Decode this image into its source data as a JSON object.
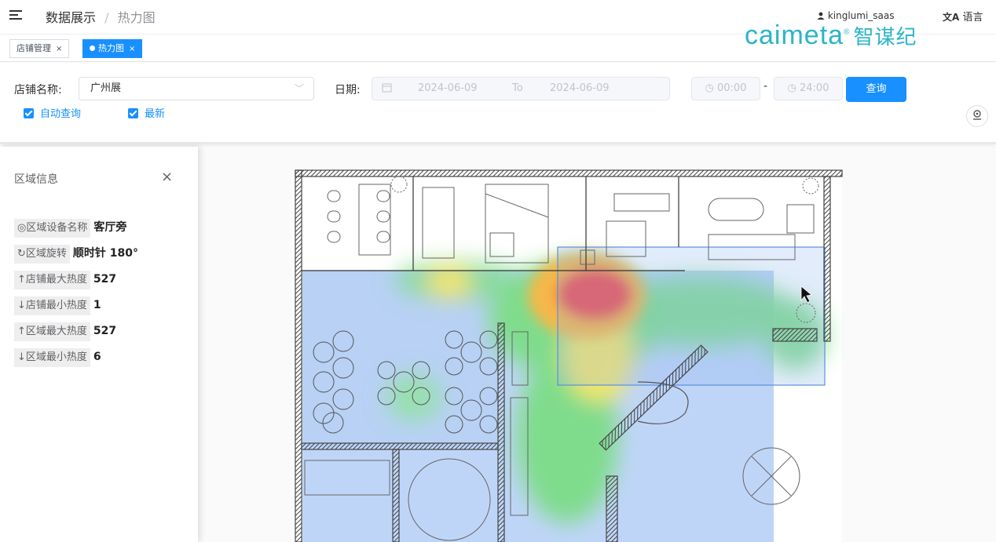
{
  "header": {
    "breadcrumb_root": "数据展示",
    "breadcrumb_sep": "/",
    "breadcrumb_current": "热力图",
    "user_name": "kinglumi_saas",
    "language": "语言",
    "logo_text": "caimeta",
    "logo_mark": "®",
    "logo_cn": "智谋纪"
  },
  "tabs": [
    {
      "label": "店铺管理",
      "close": "×",
      "active": false
    },
    {
      "label": "热力图",
      "close": "×",
      "active": true
    }
  ],
  "filter": {
    "store_label": "店铺名称:",
    "store_value": "广州展",
    "date_label": "日期:",
    "date_start": "2024-06-09",
    "date_to": "To",
    "date_end": "2024-06-09",
    "time_start": "00:00",
    "time_dash": "-",
    "time_end": "24:00",
    "query_button": "查询",
    "auto_query": "自动查询",
    "latest": "最新"
  },
  "panel": {
    "title": "区域信息",
    "close": "×",
    "rows": [
      {
        "label": "◎区域设备名称",
        "value": "客厅旁"
      },
      {
        "label": "↻区域旋转",
        "value": "顺时针 180°"
      },
      {
        "label": "↑店铺最大热度",
        "value": "527"
      },
      {
        "label": "↓店铺最小热度",
        "value": "1"
      },
      {
        "label": "↑区域最大热度",
        "value": "527"
      },
      {
        "label": "↓区域最小热度",
        "value": "6"
      }
    ]
  },
  "colors": {
    "primary": "#1890ff",
    "logo": "#2bb5c7",
    "heat_low": "#a9c7f5",
    "heat_mid": "#7fdc8c",
    "heat_high": "#f5e66a",
    "heat_max": "#f05050"
  },
  "icons": {
    "menu": "menu-fold-icon",
    "user": "user-icon",
    "language": "translate-icon",
    "calendar": "calendar-icon",
    "clock": "clock-icon",
    "locate": "locate-icon",
    "cursor": "mouse-cursor-icon"
  }
}
